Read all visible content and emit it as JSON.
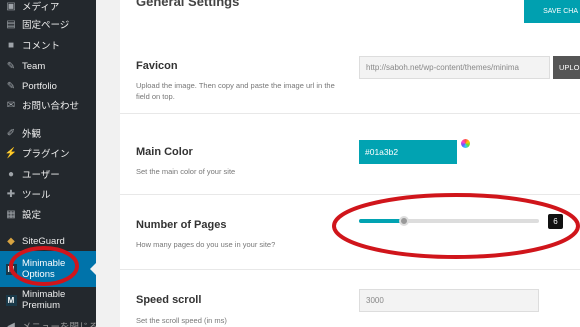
{
  "sidebar": {
    "items": [
      {
        "label": "メディア",
        "icon": "media-icon"
      },
      {
        "label": "固定ページ",
        "icon": "page-icon"
      },
      {
        "label": "コメント",
        "icon": "comment-icon"
      },
      {
        "label": "Team",
        "icon": "pin-icon"
      },
      {
        "label": "Portfolio",
        "icon": "pin-icon"
      },
      {
        "label": "お問い合わせ",
        "icon": "mail-icon"
      },
      {
        "label": "外観",
        "icon": "brush-icon"
      },
      {
        "label": "プラグイン",
        "icon": "plugin-icon"
      },
      {
        "label": "ユーザー",
        "icon": "user-icon"
      },
      {
        "label": "ツール",
        "icon": "wrench-icon"
      },
      {
        "label": "設定",
        "icon": "settings-icon"
      },
      {
        "label": "SiteGuard",
        "icon": "shield-icon"
      },
      {
        "label_line1": "Minimable",
        "label_line2": "Options",
        "icon": "minimable-icon"
      },
      {
        "label_line1": "Minimable",
        "label_line2": "Premium",
        "icon": "minimable-icon"
      },
      {
        "label": "メニューを閉じる",
        "icon": "collapse-icon"
      }
    ]
  },
  "header": {
    "title": "General Settings",
    "save_label": "SAVE CHA"
  },
  "settings": {
    "favicon": {
      "title": "Favicon",
      "desc": "Upload the image. Then copy and paste the image url in the field on top.",
      "value": "http://saboh.net/wp-content/themes/minima",
      "upload_label": "UPLO"
    },
    "main_color": {
      "title": "Main Color",
      "desc": "Set the main color of your site",
      "value": "#01a3b2"
    },
    "pages": {
      "title": "Number of Pages",
      "desc": "How many pages do you use in your site?",
      "value": "6",
      "fill_fraction": 0.25
    },
    "speed": {
      "title": "Speed scroll",
      "desc": "Set the scroll speed (in ms)",
      "placeholder": "3000"
    }
  },
  "colors": {
    "accent": "#01a3b2",
    "sidebar_bg": "#23282d",
    "active_bg": "#0073aa",
    "annotation": "#d0151b"
  }
}
